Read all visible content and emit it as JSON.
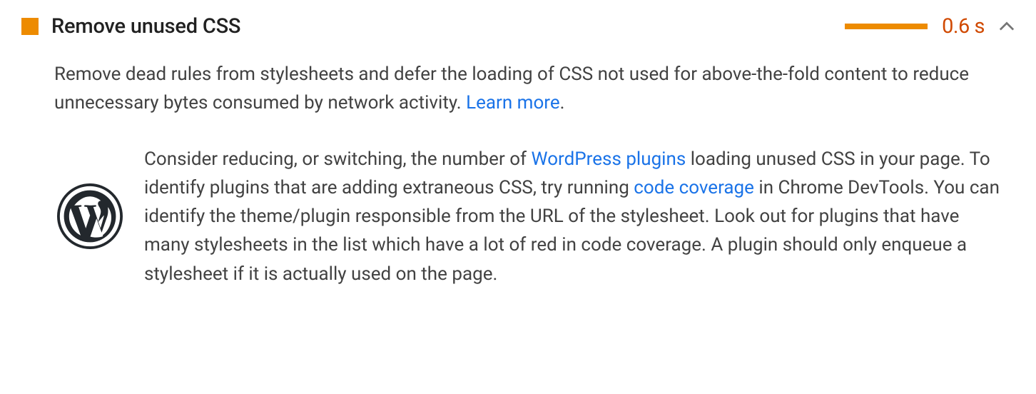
{
  "audit": {
    "title": "Remove unused CSS",
    "score_value": "0.6 s",
    "description_before_link": "Remove dead rules from stylesheets and defer the loading of CSS not used for above-the-fold content to reduce unnecessary bytes consumed by network activity. ",
    "learn_more": "Learn more",
    "period": "."
  },
  "stack_pack": {
    "segment1": "Consider reducing, or switching, the number of ",
    "link1": "WordPress plugins",
    "segment2": " loading unused CSS in your page. To identify plugins that are adding extraneous CSS, try running ",
    "link2": "code coverage",
    "segment3": " in Chrome DevTools. You can identify the theme/plugin responsible from the URL of the stylesheet. Look out for plugins that have many stylesheets in the list which have a lot of red in code coverage. A plugin should only enqueue a stylesheet if it is actually used on the page."
  }
}
